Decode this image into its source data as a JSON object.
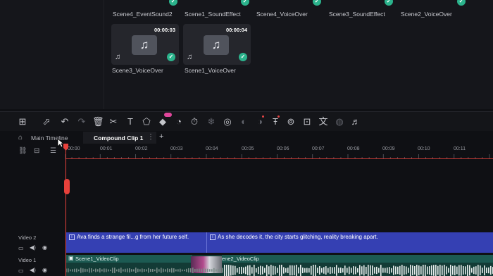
{
  "media": {
    "top_row": [
      {
        "label": "Scene4_EventSound2",
        "checked": true
      },
      {
        "label": "Scene1_SoundEffect",
        "checked": true
      },
      {
        "label": "Scene4_VoiceOver",
        "checked": true
      },
      {
        "label": "Scene3_SoundEffect",
        "checked": true
      },
      {
        "label": "Scene2_VoiceOver",
        "checked": true
      }
    ],
    "tiles": [
      {
        "label": "Scene3_VoiceOver",
        "duration": "00:00:03",
        "checked": true
      },
      {
        "label": "Scene1_VoiceOver",
        "duration": "00:00:04",
        "checked": true
      }
    ]
  },
  "toolbar": {
    "tools": [
      "layout-icon",
      "select-icon",
      "undo-icon",
      "redo-icon",
      "delete-icon",
      "cut-icon",
      "text-icon",
      "crop-icon",
      "keyframe-icon",
      "speed-icon",
      "timer-icon",
      "freeze-icon",
      "ai-icon",
      "mask-icon",
      "color-match-icon",
      "ai-voice-icon",
      "tts-icon",
      "stabilize-icon",
      "subtitle-icon",
      "translate-icon",
      "color-icon",
      "audio-sync-icon"
    ],
    "new_badge_color": "#e0469b"
  },
  "tabs": {
    "main": "Main Timeline",
    "compound": "Compound Clip 1",
    "more": "⋮",
    "add": "+"
  },
  "ruler": {
    "start": "00:00",
    "ticks": [
      "00:01",
      "00:02",
      "00:03",
      "00:04",
      "00:05",
      "00:06",
      "00:07",
      "00:08",
      "00:09",
      "00:10",
      "00:11"
    ]
  },
  "tracks": {
    "video2": {
      "name": "Video 2",
      "clips": [
        {
          "text": "Ava finds a strange fil...g from her future self."
        },
        {
          "text": "As she decodes it, the city starts glitching, reality breaking apart."
        }
      ]
    },
    "video1": {
      "name": "Video 1",
      "clips": [
        {
          "label": "Scene1_VideoClip"
        },
        {
          "label": "ene2_VideoClip"
        }
      ]
    }
  },
  "colors": {
    "playhead": "#e8413b",
    "text_track": "#3540b3",
    "video_track": "#133b36",
    "check": "#2bb38c"
  }
}
